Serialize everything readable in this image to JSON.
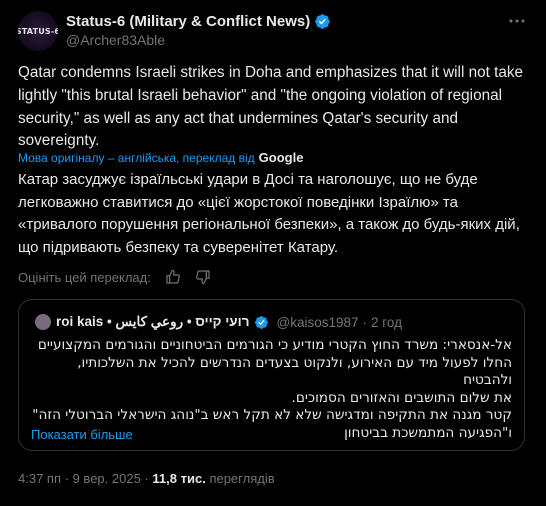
{
  "author": {
    "avatar_text": "STATUS-6",
    "name": "Status-6 (Military & Conflict News)",
    "handle": "@Archer83Able",
    "verified_color": "#1d9bf0"
  },
  "more_icon": "more-horizontal-icon",
  "tweet": {
    "text": "Qatar condemns Israeli strikes in Doha and emphasizes that it will not take lightly \"this brutal Israeli behavior\" and \"the ongoing violation of regional security,\" as well as any act that undermines Qatar's security and sovereignty."
  },
  "translation": {
    "link_label": "Мова оригіналу – англійська, переклад від",
    "provider": "Google",
    "text": "Катар засуджує ізраїльські удари в Досі та наголошує, що не буде легковажно ставитися до «цієї жорстокої поведінки Ізраїлю» та «тривалого порушення регіональної безпеки», а також до будь-яких дій, що підривають безпеку та суверенітет Катару.",
    "rate_label": "Оцініть цей переклад:",
    "rate_icons": [
      "thumbs-up-icon",
      "thumbs-down-icon"
    ]
  },
  "quote": {
    "name": "roi kais • רועי קייס • روعي كايس",
    "handle": "@kaisos1987",
    "separator": "·",
    "time": "2 год",
    "lines": [
      "אל-אנסארי: משרד החוץ הקטרי מודיע כי הגורמים הביטחוניים והגורמים המקצועיים",
      "החלו לפעול מיד עם האירוע, ולנקוט בצעדים הנדרשים להכיל את השלכותיו, ולהבטיח",
      "את שלום התושבים והאזורים הסמוכים.",
      "קטר מגנה את התקיפה ומדגישה שלא לא תקל ראש ב\"נוהג הישראלי הברוטלי הזה\"",
      "ו\"הפגיעה המתמשכת בביטחון"
    ],
    "show_more": "Показати більше"
  },
  "footer": {
    "time": "4:37 пп",
    "date": "9 вер. 2025",
    "separator": "·",
    "views_count": "11,8 тис.",
    "views_label": "переглядів"
  }
}
